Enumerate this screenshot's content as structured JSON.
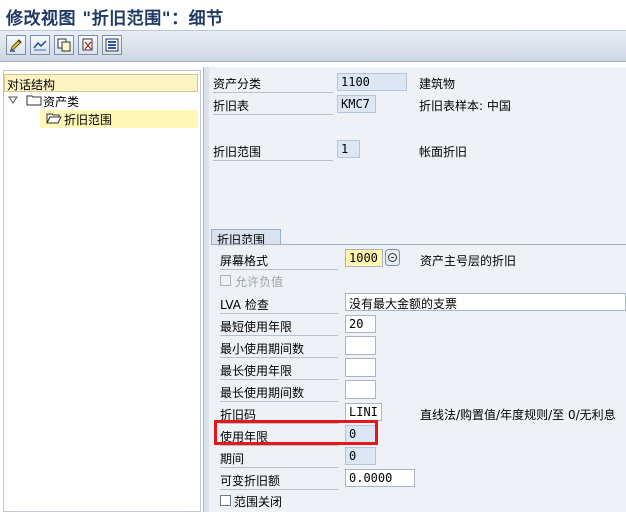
{
  "title": "修改视图 \"折旧范围\"：细节",
  "toolbar": {
    "icons": [
      "edit-pen-icon",
      "display-change-icon",
      "copy-icon",
      "delete-icon",
      "select-all-icon"
    ]
  },
  "tree": {
    "header": "对话结构",
    "items": [
      {
        "label": "资产类",
        "level": 0,
        "expanded": true,
        "selected": false
      },
      {
        "label": "折旧范围",
        "level": 1,
        "expanded": false,
        "selected": true
      }
    ]
  },
  "header_fields": {
    "asset_class": {
      "label": "资产分类",
      "value": "1100",
      "desc": "建筑物"
    },
    "dep_table": {
      "label": "折旧表",
      "value": "KMC7",
      "desc": "折旧表样本: 中国"
    },
    "dep_area": {
      "label": "折旧范围",
      "value": "1",
      "desc": "帐面折旧"
    }
  },
  "group": {
    "title": "折旧范围",
    "screen_layout": {
      "label": "屏幕格式",
      "value": "1000",
      "desc": "资产主号层的折旧"
    },
    "allow_negative": {
      "label": "允许负值",
      "checked": false,
      "disabled": true
    },
    "lva_check": {
      "label": "LVA 检查",
      "value": "没有最大金额的支票"
    },
    "min_life": {
      "label": "最短使用年限",
      "value": "20"
    },
    "min_periods": {
      "label": "最小使用期间数",
      "value": ""
    },
    "max_life": {
      "label": "最长使用年限",
      "value": ""
    },
    "max_periods": {
      "label": "最长使用期间数",
      "value": ""
    },
    "dep_key": {
      "label": "折旧码",
      "value": "LINI",
      "desc": "直线法/购置值/年度规则/至 0/无利息"
    },
    "useful_life": {
      "label": "使用年限",
      "value": "0"
    },
    "period": {
      "label": "期间",
      "value": "0"
    },
    "variable_dep": {
      "label": "可变折旧额",
      "value": "0.0000"
    },
    "area_closed": {
      "label": "范围关闭",
      "checked": false
    }
  },
  "colors": {
    "highlight": "#e8161a",
    "title": "#1f3a63",
    "readonly_field": "#dce6f4"
  }
}
